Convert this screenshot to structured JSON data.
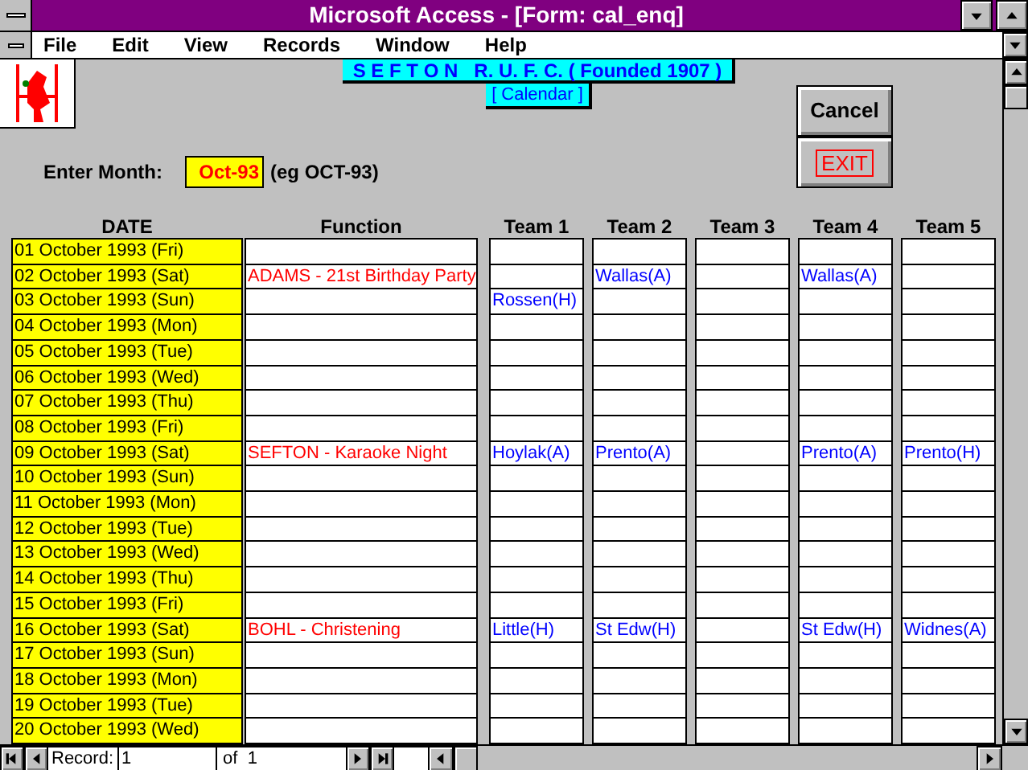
{
  "window": {
    "title": "Microsoft Access - [Form: cal_enq]"
  },
  "menu": [
    "File",
    "Edit",
    "View",
    "Records",
    "Window",
    "Help"
  ],
  "form": {
    "title": "S E F T O N   R. U. F. C. ( Founded 1907 )",
    "subtitle": "[ Calendar ]",
    "month_label": "Enter Month:",
    "month_value": "Oct-93",
    "month_hint": "(eg OCT-93)",
    "buttons": [
      {
        "label": "Cancel",
        "kind": "normal"
      },
      {
        "label": "EXIT",
        "kind": "exit"
      }
    ]
  },
  "table": {
    "columns": [
      "DATE",
      "Function",
      "Team 1",
      "Team 2",
      "Team 3",
      "Team 4",
      "Team 5"
    ],
    "rows": [
      {
        "date": "01 October 1993  (Fri)"
      },
      {
        "date": "02 October 1993  (Sat)",
        "function": "ADAMS - 21st Birthday Party",
        "team_2": "Wallas(A)",
        "team_4": "Wallas(A)"
      },
      {
        "date": "03 October 1993  (Sun)",
        "team_1": "Rossen(H)"
      },
      {
        "date": "04 October 1993  (Mon)"
      },
      {
        "date": "05 October 1993  (Tue)"
      },
      {
        "date": "06 October 1993  (Wed)"
      },
      {
        "date": "07 October 1993  (Thu)"
      },
      {
        "date": "08 October 1993  (Fri)"
      },
      {
        "date": "09 October 1993  (Sat)",
        "function": "SEFTON - Karaoke Night",
        "team_1": "Hoylak(A)",
        "team_2": "Prento(A)",
        "team_4": "Prento(A)",
        "team_5": "Prento(H)"
      },
      {
        "date": "10 October 1993  (Sun)"
      },
      {
        "date": "11 October 1993  (Mon)"
      },
      {
        "date": "12 October 1993  (Tue)"
      },
      {
        "date": "13 October 1993  (Wed)"
      },
      {
        "date": "14 October 1993  (Thu)"
      },
      {
        "date": "15 October 1993  (Fri)"
      },
      {
        "date": "16 October 1993  (Sat)",
        "function": "BOHL - Christening",
        "team_1": "Little(H)",
        "team_2": "St Edw(H)",
        "team_4": "St Edw(H)",
        "team_5": "Widnes(A)"
      },
      {
        "date": "17 October 1993  (Sun)"
      },
      {
        "date": "18 October 1993  (Mon)"
      },
      {
        "date": "19 October 1993  (Tue)"
      },
      {
        "date": "20 October 1993  (Wed)"
      }
    ]
  },
  "record_nav": {
    "label": "Record:",
    "value": "1",
    "total": "of  1"
  }
}
